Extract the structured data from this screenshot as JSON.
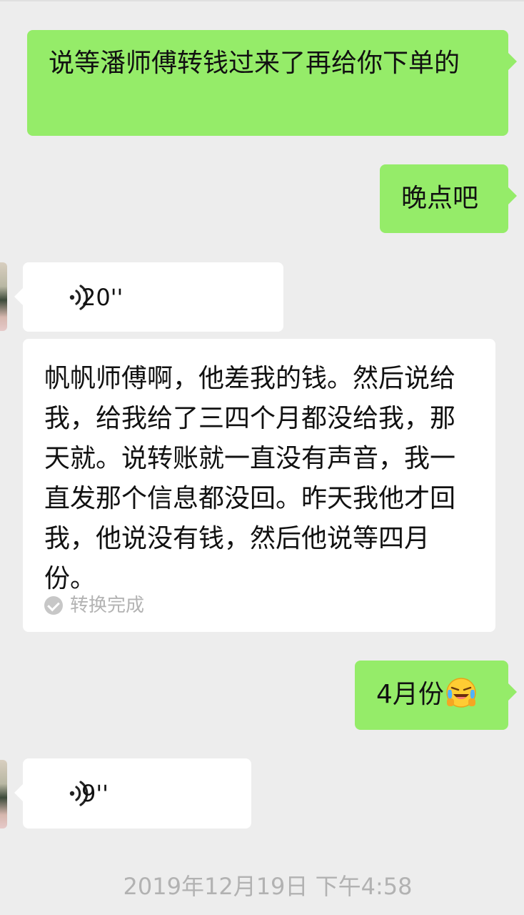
{
  "messages": [
    {
      "direction": "outgoing",
      "type": "text",
      "text": "说等潘师傅转钱过来了再给你下单的"
    },
    {
      "direction": "outgoing",
      "type": "text",
      "text": "晚点吧"
    },
    {
      "direction": "incoming",
      "type": "voice",
      "duration": "20''"
    },
    {
      "direction": "incoming",
      "type": "voice-transcript",
      "text": "帆帆师傅啊，他差我的钱。然后说给我，给我给了三四个月都没给我，那天就。说转账就一直没有声音，我一直发那个信息都没回。昨天我他才回我，他说没有钱，然后他说等四月份。",
      "status": "转换完成"
    },
    {
      "direction": "outgoing",
      "type": "text",
      "text": "4月份",
      "emoji": "laughing-crying-emoji"
    },
    {
      "direction": "incoming",
      "type": "voice",
      "duration": "9''"
    }
  ],
  "timestamp": "2019年12月19日 下午4:58",
  "colors": {
    "background": "#ededed",
    "outgoing_bubble": "#95ec69",
    "incoming_bubble": "#ffffff",
    "muted_text": "#b2b2b2"
  }
}
